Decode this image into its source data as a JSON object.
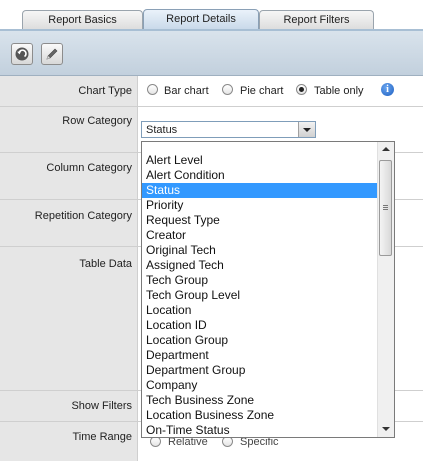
{
  "tabs": [
    {
      "label": "Report Basics"
    },
    {
      "label": "Report Details"
    },
    {
      "label": "Report Filters"
    }
  ],
  "toolbar": {
    "back_icon": "back-arrow-icon",
    "edit_icon": "pencil-icon"
  },
  "form": {
    "chart_type": {
      "label": "Chart Type",
      "options": [
        "Bar chart",
        "Pie chart",
        "Table only"
      ],
      "selected": "Table only"
    },
    "row_category": {
      "label": "Row Category",
      "value": "Status"
    },
    "column_category": {
      "label": "Column Category"
    },
    "repetition_category": {
      "label": "Repetition Category"
    },
    "table_data": {
      "label": "Table Data"
    },
    "show_filters": {
      "label": "Show Filters"
    },
    "time_range": {
      "label": "Time Range",
      "partial_options": [
        "Relative",
        "Specific"
      ]
    }
  },
  "dropdown": {
    "items": [
      "Alert Level",
      "Alert Condition",
      "Status",
      "Priority",
      "Request Type",
      "Creator",
      "Original Tech",
      "Assigned Tech",
      "Tech Group",
      "Tech Group Level",
      "Location",
      "Location ID",
      "Location Group",
      "Department",
      "Department Group",
      "Company",
      "Tech Business Zone",
      "Location Business Zone",
      "On-Time Status"
    ],
    "selected": "Status"
  },
  "colors": {
    "selection": "#3399ff",
    "label_bg": "#e6e6e6",
    "accent": "#c6d7e8"
  }
}
